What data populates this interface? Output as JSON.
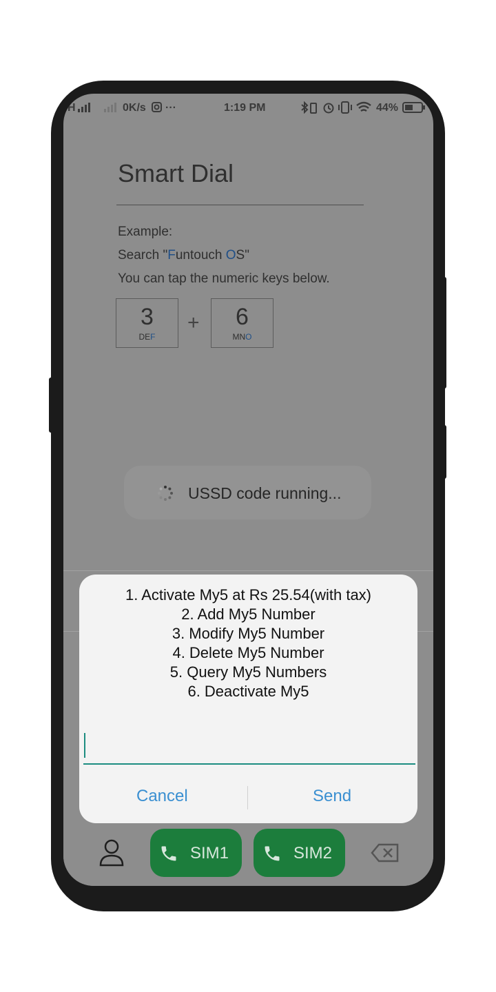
{
  "status": {
    "network": "H",
    "speed": "0K/s",
    "time": "1:19 PM",
    "battery": "44%"
  },
  "smart_dial": {
    "title": "Smart Dial",
    "example_label": "Example:",
    "search_prefix": "Search \"",
    "search_f": "F",
    "search_mid": "untouch ",
    "search_o": "O",
    "search_suffix": "S\"",
    "hint": "You can tap the numeric keys below.",
    "key1": {
      "num": "3",
      "letters": "DE",
      "letters_hl": "F"
    },
    "plus": "+",
    "key2": {
      "num": "6",
      "letters": "MN",
      "letters_hl": "O"
    }
  },
  "toast": {
    "text": "USSD code running..."
  },
  "dialog": {
    "lines": [
      "1. Activate My5 at Rs 25.54(with tax)",
      "2. Add My5 Number",
      "3. Modify My5 Number",
      "4. Delete My5 Number",
      "5. Query My5 Numbers",
      "6. Deactivate My5"
    ],
    "input_value": "",
    "cancel_label": "Cancel",
    "send_label": "Send"
  },
  "bottom_bar": {
    "sim1_label": "SIM1",
    "sim2_label": "SIM2"
  },
  "colors": {
    "sim_button": "#1c7d3c",
    "dialog_button": "#3a8fd1",
    "input_underline": "#1b8c80",
    "highlight": "#1f4f87"
  },
  "icons": [
    "signal-icon",
    "bluetooth-icon",
    "vibrate-icon",
    "alarm-icon",
    "wifi-icon",
    "battery-icon",
    "contacts-icon",
    "phone-icon",
    "backspace-icon",
    "spinner-icon"
  ]
}
